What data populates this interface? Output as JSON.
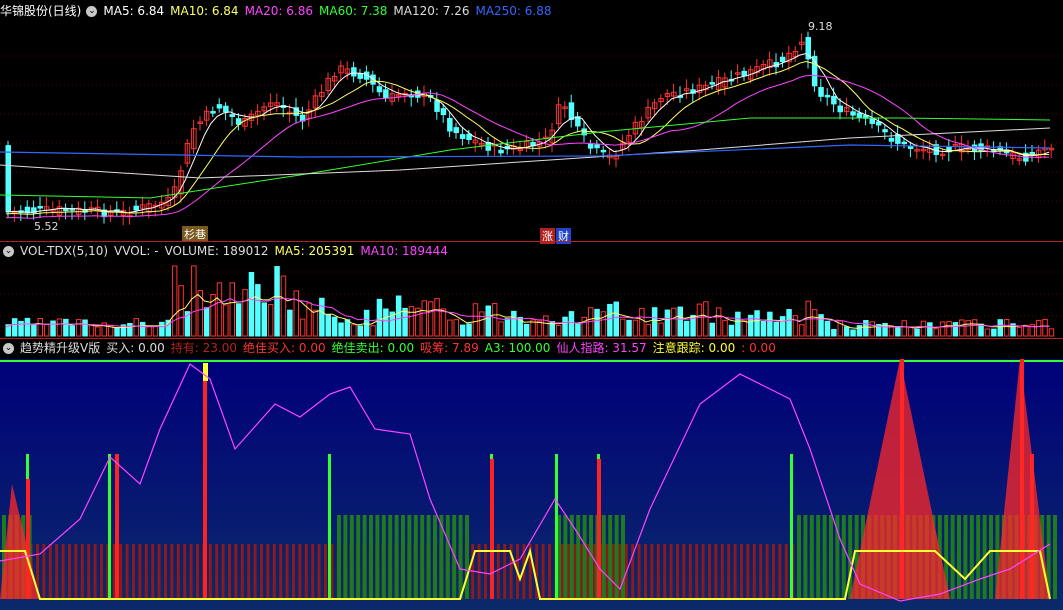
{
  "main_header": {
    "stock": "华锦股份(日线)",
    "items": [
      {
        "label": "MA5: 6.84",
        "color": "#ffffff"
      },
      {
        "label": "MA10: 6.84",
        "color": "#ffff66"
      },
      {
        "label": "MA20: 6.86",
        "color": "#ff44ff"
      },
      {
        "label": "MA60: 7.38",
        "color": "#33ff33"
      },
      {
        "label": "MA120: 7.26",
        "color": "#dddddd"
      },
      {
        "label": "MA250: 6.88",
        "color": "#3366ff"
      }
    ]
  },
  "price_labels": {
    "high": "9.18",
    "low": "5.52"
  },
  "tags": {
    "left": "杉巷",
    "right_a": "涨",
    "right_b": "财"
  },
  "vol_header": {
    "items": [
      {
        "label": "VOL-TDX(5,10)",
        "color": "#dddddd"
      },
      {
        "label": "VVOL: -",
        "color": "#dddddd"
      },
      {
        "label": "VOLUME: 189012",
        "color": "#dddddd"
      },
      {
        "label": "MA5: 205391",
        "color": "#ffff66"
      },
      {
        "label": "MA10: 189444",
        "color": "#ff44ff"
      }
    ]
  },
  "ind_header": {
    "items": [
      {
        "label": "趋势精升级V版",
        "color": "#dddddd"
      },
      {
        "label": "买入: 0.00",
        "color": "#dddddd"
      },
      {
        "label": "持有: 23.00",
        "color": "#b22222"
      },
      {
        "label": "绝佳买入: 0.00",
        "color": "#ff3333"
      },
      {
        "label": "绝佳卖出: 0.00",
        "color": "#33ff33"
      },
      {
        "label": "吸筹: 7.89",
        "color": "#ff3333"
      },
      {
        "label": "A3: 100.00",
        "color": "#33ff33"
      },
      {
        "label": "仙人指路: 31.57",
        "color": "#ff44ff"
      },
      {
        "label": "注意跟踪: 0.00",
        "color": "#ffff33"
      },
      {
        "label": ": 0.00",
        "color": "#ff3333"
      }
    ]
  },
  "colors": {
    "up": "#ff3333",
    "down": "#54ffff",
    "bg": "#000000",
    "blue_bg": "#000080",
    "grid": "#8b0000"
  }
}
